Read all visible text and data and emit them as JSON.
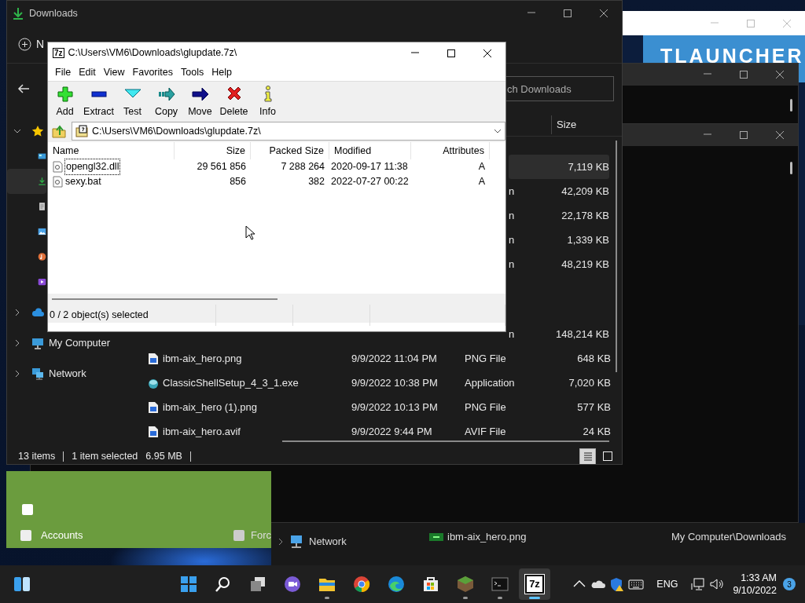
{
  "tlauncher": {
    "banner_text": "TLAUNCHER"
  },
  "accounts_window": {
    "top_checkbox": {
      "checked": false
    },
    "options": [
      {
        "label": "Accounts",
        "checked": false
      },
      {
        "label": "Forc",
        "checked": false
      }
    ]
  },
  "recent_window": {
    "sidebar_item": "Network",
    "rows": [
      {
        "kind": "banner",
        "name": "ibm-aix_hero.png",
        "location": "My Computer\\Downloads"
      }
    ]
  },
  "explorer": {
    "title": "Downloads",
    "new_label": "N",
    "search_placeholder": "ch Downloads",
    "size_header": "Size",
    "sidebar": [
      {
        "kind": "star",
        "expanded": true,
        "children": [
          {
            "kind": "desktop",
            "selected": false
          },
          {
            "kind": "download",
            "selected": true
          },
          {
            "kind": "document",
            "selected": false
          },
          {
            "kind": "pictures",
            "selected": false
          },
          {
            "kind": "music",
            "selected": false
          },
          {
            "kind": "videos",
            "selected": false
          }
        ]
      },
      {
        "kind": "cloud",
        "expanded": false
      },
      {
        "kind": "computer",
        "label": "My Computer",
        "expanded": false
      },
      {
        "kind": "network",
        "label": "Network",
        "expanded": false
      }
    ],
    "rows": [
      {
        "size": "7,119 KB",
        "selected": true
      },
      {
        "type": "n",
        "size": "42,209 KB",
        "selected": false
      },
      {
        "type": "n",
        "size": "22,178 KB",
        "selected": false
      },
      {
        "type": "n",
        "size": "1,339 KB",
        "selected": false
      },
      {
        "type": "n",
        "size": "48,219 KB",
        "selected": false
      },
      {
        "type": "n",
        "size": "148,214 KB",
        "selected": false
      },
      {
        "kind": "image",
        "name": "ibm-aix_hero.png",
        "date": "9/9/2022 11:04 PM",
        "type": "PNG File",
        "size": "648 KB",
        "selected": false
      },
      {
        "kind": "setup",
        "name": "ClassicShellSetup_4_3_1.exe",
        "date": "9/9/2022 10:38 PM",
        "type": "Application",
        "size": "7,020 KB",
        "selected": false
      },
      {
        "kind": "image",
        "name": "ibm-aix_hero (1).png",
        "date": "9/9/2022 10:13 PM",
        "type": "PNG File",
        "size": "577 KB",
        "selected": false
      },
      {
        "kind": "image",
        "name": "ibm-aix_hero.avif",
        "date": "9/9/2022 9:44 PM",
        "type": "AVIF File",
        "size": "24 KB",
        "selected": false
      }
    ],
    "status": {
      "count": "13 items",
      "selection": "1 item selected",
      "selection_size": "6.95 MB"
    },
    "views": [
      {
        "kind": "details",
        "selected": true
      },
      {
        "kind": "tiles",
        "selected": false
      }
    ]
  },
  "sevenzip": {
    "icon_text": "7z",
    "title": "C:\\Users\\VM6\\Downloads\\glupdate.7z\\",
    "menu": [
      "File",
      "Edit",
      "View",
      "Favorites",
      "Tools",
      "Help"
    ],
    "toolbar": [
      {
        "kind": "add",
        "label": "Add"
      },
      {
        "kind": "extract",
        "label": "Extract"
      },
      {
        "kind": "test",
        "label": "Test"
      },
      {
        "kind": "copy",
        "label": "Copy"
      },
      {
        "kind": "move",
        "label": "Move"
      },
      {
        "kind": "delete",
        "label": "Delete"
      },
      {
        "kind": "info",
        "label": "Info"
      }
    ],
    "path": "C:\\Users\\VM6\\Downloads\\glupdate.7z\\",
    "columns": [
      "Name",
      "Size",
      "Packed Size",
      "Modified",
      "Attributes"
    ],
    "files": [
      {
        "name": "opengl32.dll",
        "size": "29 561 856",
        "packed_size": "7 288 264",
        "modified": "2020-09-17 11:38",
        "attributes": "A",
        "focused": true
      },
      {
        "name": "sexy.bat",
        "size": "856",
        "packed_size": "382",
        "modified": "2022-07-27 00:22",
        "attributes": "A",
        "focused": false
      }
    ],
    "status": "0 / 2 object(s) selected"
  },
  "taskbar": {
    "items": [
      {
        "kind": "widgets",
        "running": false,
        "active": false
      },
      {
        "kind": "start",
        "running": false,
        "active": false
      },
      {
        "kind": "search",
        "running": false,
        "active": false
      },
      {
        "kind": "taskview",
        "running": false,
        "active": false
      },
      {
        "kind": "chat",
        "running": false,
        "active": false
      },
      {
        "kind": "explorer",
        "running": true,
        "active": false
      },
      {
        "kind": "chrome",
        "running": false,
        "active": false
      },
      {
        "kind": "edge",
        "running": false,
        "active": false
      },
      {
        "kind": "store",
        "running": false,
        "active": false
      },
      {
        "kind": "minecraft",
        "running": true,
        "active": false
      },
      {
        "kind": "terminal",
        "running": true,
        "active": false
      },
      {
        "kind": "sevenzip",
        "label": "7z",
        "running": true,
        "active": true
      }
    ],
    "language": "ENG",
    "time": "1:33 AM",
    "date": "9/10/2022",
    "notifications": "3"
  }
}
